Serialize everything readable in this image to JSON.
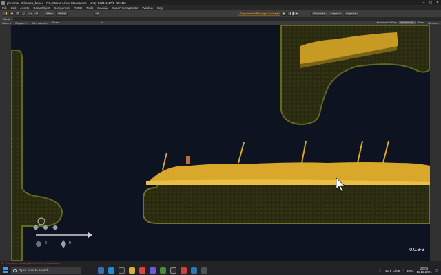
{
  "window": {
    "title": "plevania - DibLabs_baked - PC, Mac & Linux Standalone - Unity 2021.1.17f1 <DX11>",
    "controls": [
      "–",
      "▢",
      "✕"
    ]
  },
  "menu": [
    "File",
    "Edit",
    "Assets",
    "GameObject",
    "Component",
    "FMOD",
    "Tools",
    "Sevania",
    "SuperTilemapEditor",
    "Window",
    "Help"
  ],
  "toolbar": {
    "left_buttons": [
      "Pivot",
      "Global"
    ],
    "warning": "Experimental Packages In Use ▾",
    "account": "Account ▾",
    "layers": "Layers ▾",
    "layout": "Layout ▾"
  },
  "tabs": [
    "Game"
  ],
  "gamebar": {
    "display": "Game ▾",
    "display_n": "Display 1 ▾",
    "aspect": "16:9 Aspect ▾",
    "scale_label": "Scale",
    "scale_value": "1x",
    "options": [
      "Maximize On Play",
      "Mute Audio",
      "Stats",
      "Gizmos ▾"
    ]
  },
  "game": {
    "version": "0.0.8-3",
    "hud": {
      "gem_count": "0",
      "item_count": "0"
    }
  },
  "status": {
    "error": "Exception: Invalid parameter for event instance"
  },
  "taskbar": {
    "search_placeholder": "Type here to search",
    "weather": "41°F  Clear",
    "lang": "ENG",
    "time": "22:06",
    "date": "11.12.2021"
  },
  "colors": {
    "game_bg": "#0d1321",
    "dirt": "#2b2a10",
    "grass": "#d9a82a",
    "warning": "#e8b040"
  }
}
